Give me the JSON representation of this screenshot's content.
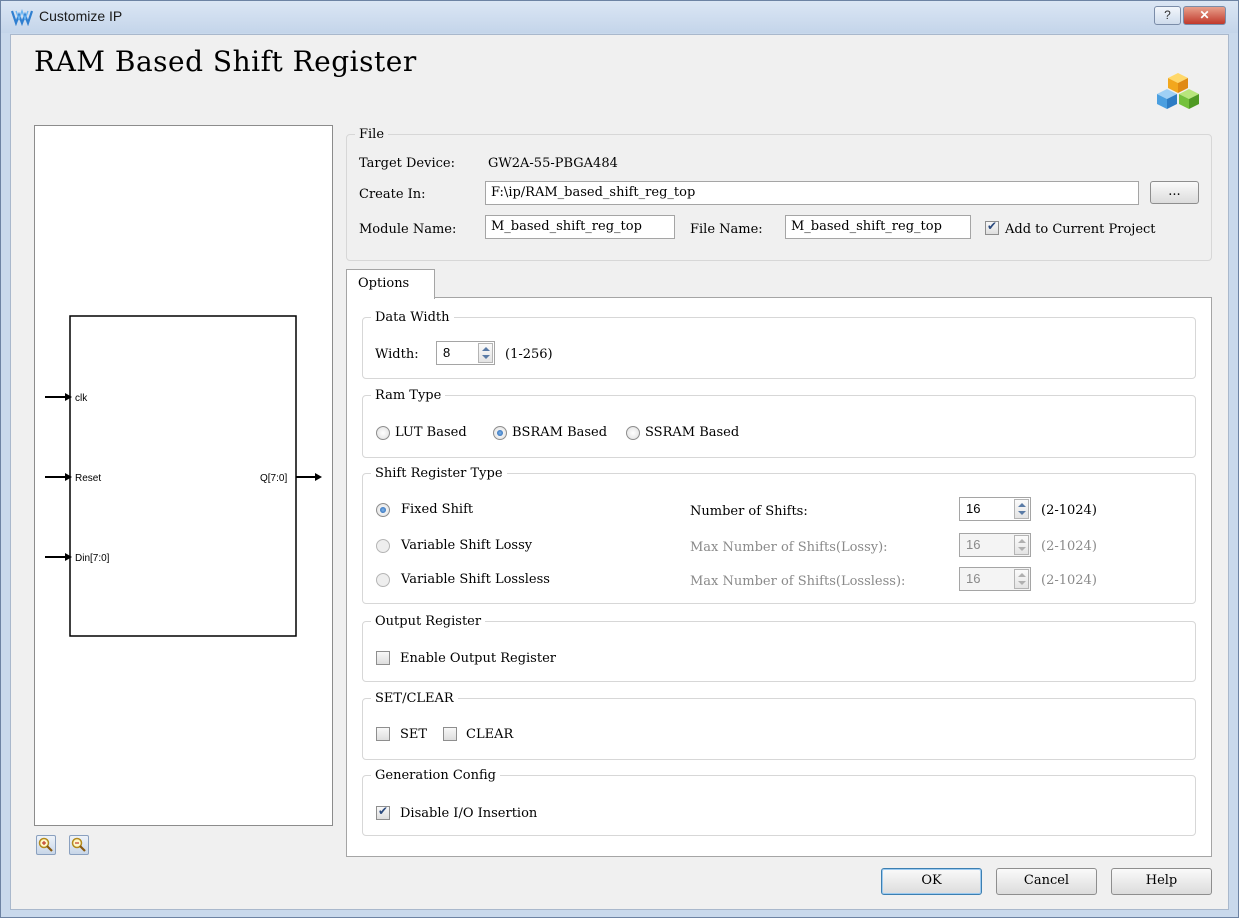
{
  "window": {
    "title": "Customize IP",
    "help_button": "?",
    "close_button": "✕"
  },
  "header": {
    "title": "RAM Based Shift Register"
  },
  "diagram": {
    "ports_in": [
      "clk",
      "Reset",
      "Din[7:0]"
    ],
    "port_out": "Q[7:0]"
  },
  "file": {
    "legend": "File",
    "target_device_label": "Target Device:",
    "target_device_value": "GW2A-55-PBGA484",
    "create_in_label": "Create In:",
    "create_in_value": "F:\\ip/RAM_based_shift_reg_top",
    "browse_label": "...",
    "module_name_label": "Module Name:",
    "module_name_value": "M_based_shift_reg_top",
    "file_name_label": "File Name:",
    "file_name_value": "M_based_shift_reg_top",
    "add_to_project_label": "Add to Current Project",
    "add_to_project_checked": true
  },
  "tabs": [
    {
      "label": "Options"
    }
  ],
  "options": {
    "data_width": {
      "legend": "Data Width",
      "width_label": "Width:",
      "width_value": "8",
      "range": "(1-256)"
    },
    "ram_type": {
      "legend": "Ram Type",
      "choices": [
        "LUT Based",
        "BSRAM Based",
        "SSRAM Based"
      ],
      "selected": "BSRAM Based"
    },
    "shift_register_type": {
      "legend": "Shift Register Type",
      "rows": [
        {
          "label": "Fixed Shift",
          "selected": true,
          "param_label": "Number of Shifts:",
          "value": "16",
          "range": "(2-1024)",
          "enabled": true
        },
        {
          "label": "Variable Shift Lossy",
          "selected": false,
          "param_label": "Max Number of Shifts(Lossy):",
          "value": "16",
          "range": "(2-1024)",
          "enabled": false
        },
        {
          "label": "Variable Shift Lossless",
          "selected": false,
          "param_label": "Max Number of Shifts(Lossless):",
          "value": "16",
          "range": "(2-1024)",
          "enabled": false
        }
      ]
    },
    "output_register": {
      "legend": "Output Register",
      "enable_label": "Enable Output Register",
      "checked": false
    },
    "set_clear": {
      "legend": "SET/CLEAR",
      "set_label": "SET",
      "clear_label": "CLEAR",
      "set_checked": false,
      "clear_checked": false
    },
    "generation_config": {
      "legend": "Generation Config",
      "disable_io_label": "Disable I/O Insertion",
      "checked": true
    }
  },
  "buttons": {
    "ok": "OK",
    "cancel": "Cancel",
    "help": "Help"
  },
  "colors": {
    "title_bar": "#c9d9ec",
    "close_button": "#c0392b",
    "radio_selected": "#1f5fae"
  }
}
